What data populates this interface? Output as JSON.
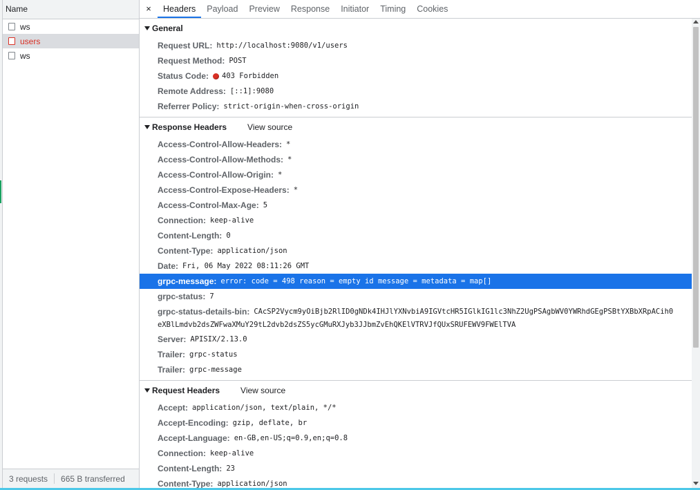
{
  "list": {
    "header": "Name",
    "requests": [
      {
        "name": "ws",
        "state": "normal"
      },
      {
        "name": "users",
        "state": "error"
      },
      {
        "name": "ws",
        "state": "normal"
      }
    ],
    "status": {
      "requests": "3 requests",
      "transferred": "665 B transferred"
    }
  },
  "tabs": {
    "close": "×",
    "items": [
      "Headers",
      "Payload",
      "Preview",
      "Response",
      "Initiator",
      "Timing",
      "Cookies"
    ],
    "active": "Headers"
  },
  "general": {
    "title": "General",
    "rows": [
      {
        "key": "Request URL:",
        "value": "http://localhost:9080/v1/users"
      },
      {
        "key": "Request Method:",
        "value": "POST"
      },
      {
        "key": "Status Code:",
        "value": "403 Forbidden"
      },
      {
        "key": "Remote Address:",
        "value": "[::1]:9080"
      },
      {
        "key": "Referrer Policy:",
        "value": "strict-origin-when-cross-origin"
      }
    ]
  },
  "response_headers": {
    "title": "Response Headers",
    "view_source": "View source",
    "rows": [
      {
        "key": "Access-Control-Allow-Headers:",
        "value": "*"
      },
      {
        "key": "Access-Control-Allow-Methods:",
        "value": "*"
      },
      {
        "key": "Access-Control-Allow-Origin:",
        "value": "*"
      },
      {
        "key": "Access-Control-Expose-Headers:",
        "value": "*"
      },
      {
        "key": "Access-Control-Max-Age:",
        "value": "5"
      },
      {
        "key": "Connection:",
        "value": "keep-alive"
      },
      {
        "key": "Content-Length:",
        "value": "0"
      },
      {
        "key": "Content-Type:",
        "value": "application/json"
      },
      {
        "key": "Date:",
        "value": "Fri, 06 May 2022 08:11:26 GMT"
      },
      {
        "key": "grpc-message:",
        "value": "error: code = 498 reason = empty id message =  metadata = map[]"
      },
      {
        "key": "grpc-status:",
        "value": "7"
      },
      {
        "key": "grpc-status-details-bin:",
        "value": "CAcSP2Vycm9yOiBjb2RlID0gNDk4IHJlYXNvbiA9IGVtcHR5IGlkIG1lc3NhZ2UgPSAgbWV0YWRhdGEgPSBtYXBbXRpACih0",
        "value_cont": "eXBlLmdvb2dsZWFwaXMuY29tL2dvb2dsZS5ycGMuRXJyb3JJbmZvEhQKElVTRVJfQUxSRUFEWV9FWElTVA"
      },
      {
        "key": "Server:",
        "value": "APISIX/2.13.0"
      },
      {
        "key": "Trailer:",
        "value": "grpc-status"
      },
      {
        "key": "Trailer:",
        "value": "grpc-message"
      }
    ]
  },
  "request_headers": {
    "title": "Request Headers",
    "view_source": "View source",
    "rows": [
      {
        "key": "Accept:",
        "value": "application/json, text/plain, */*"
      },
      {
        "key": "Accept-Encoding:",
        "value": "gzip, deflate, br"
      },
      {
        "key": "Accept-Language:",
        "value": "en-GB,en-US;q=0.9,en;q=0.8"
      },
      {
        "key": "Connection:",
        "value": "keep-alive"
      },
      {
        "key": "Content-Length:",
        "value": "23"
      },
      {
        "key": "Content-Type:",
        "value": "application/json"
      }
    ]
  },
  "colors": {
    "accent": "#1a73e8",
    "error": "#d93025",
    "selected_row": "#dadce0"
  }
}
